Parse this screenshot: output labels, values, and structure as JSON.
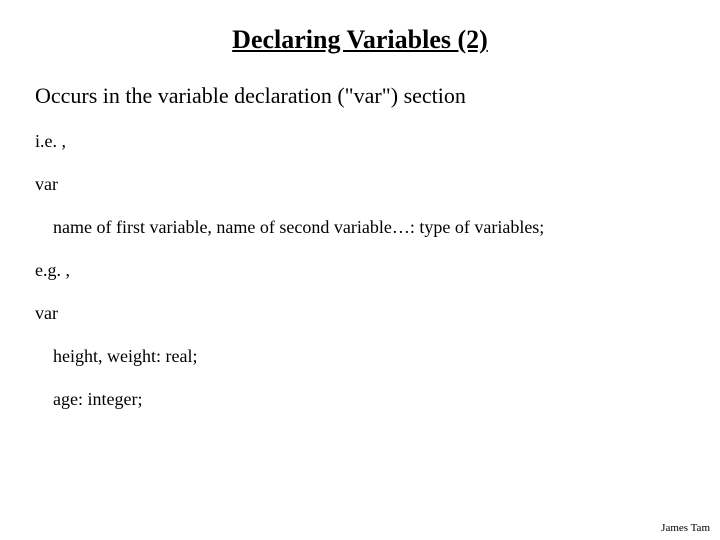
{
  "title": "Declaring Variables (2)",
  "line1": "Occurs in the variable declaration (\"var\") section",
  "line2": "i.e. ,",
  "line3": "var",
  "line4": "name of first variable, name of second variable…: type of variables;",
  "line5": "e.g. ,",
  "line6": "var",
  "line7": "height, weight: real;",
  "line8": "age: integer;",
  "footer": "James Tam"
}
